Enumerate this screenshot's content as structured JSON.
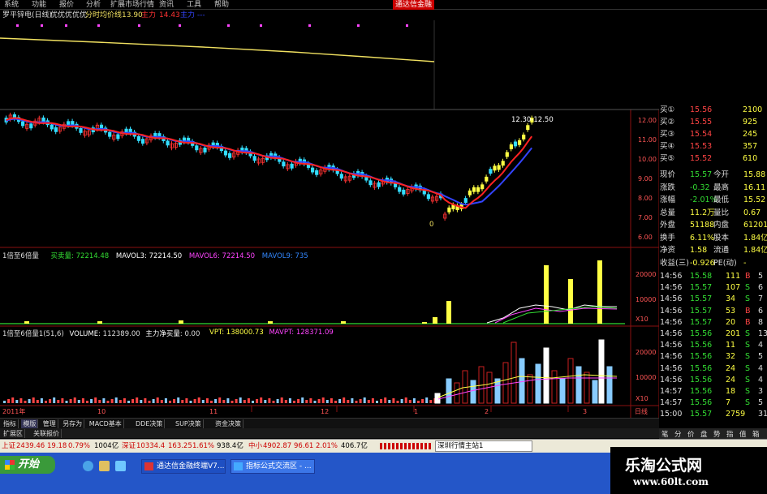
{
  "menu": {
    "items": [
      "系统",
      "功能",
      "报价",
      "分析",
      "扩展市场行情",
      "资讯",
      "工具",
      "帮助"
    ],
    "brand": "通达信金融"
  },
  "title_bar": {
    "stock": "罗平锌电(日线)",
    "indicator": "优优优优优",
    "line_label": "分时均价线",
    "line_value": "13.90",
    "leader_label": "主力",
    "leader_value": "14.43",
    "tail": "主力 ---"
  },
  "chart_data": [
    {
      "type": "line",
      "title": "",
      "y_ticks": [
        "12.00",
        "11.00",
        "10.00",
        "9.00",
        "8.00",
        "7.00",
        "6.00"
      ],
      "annotation": "12.30-12.50",
      "annotation_low": "0",
      "colors": {
        "up": "#ff3333",
        "down": "#33ddff",
        "ma1": "#ff2222",
        "ma2": "#3344ff",
        "avg": "#f0e060"
      }
    },
    {
      "type": "bar",
      "label": "1倍至6倍量",
      "items": [
        {
          "name": "买卖量",
          "value": "72214.48",
          "color": "#33dd33"
        },
        {
          "name": "MAVOL3",
          "value": "72214.50",
          "color": "#ffffff"
        },
        {
          "name": "MAVOL6",
          "value": "72214.50",
          "color": "#ff44ff"
        },
        {
          "name": "MAVOL9",
          "value": "735",
          "color": "#3388ff"
        }
      ],
      "y_ticks": [
        "20000",
        "10000",
        "X10"
      ]
    },
    {
      "type": "bar",
      "label": "1倍至6倍量1(51,6)",
      "items": [
        {
          "name": "VOLUME",
          "value": "112389.00",
          "color": "#ffffff"
        },
        {
          "name": "主力净买量",
          "value": "0.00",
          "color": "#ffffff"
        },
        {
          "name": "VPT",
          "value": "138000.73",
          "color": "#ffff44"
        },
        {
          "name": "MAVPT",
          "value": "128371.09",
          "color": "#ff44ff"
        }
      ],
      "y_ticks": [
        "20000",
        "10000",
        "X10"
      ]
    }
  ],
  "x_axis": {
    "labels": [
      "2011年",
      "10",
      "11",
      "12",
      "1",
      "2",
      "3",
      "日线"
    ]
  },
  "quote": {
    "bid_rows": [
      {
        "label": "买①",
        "price": "15.56",
        "vol": "2100"
      },
      {
        "label": "买②",
        "price": "15.55",
        "vol": "925"
      },
      {
        "label": "买③",
        "price": "15.54",
        "vol": "245"
      },
      {
        "label": "买④",
        "price": "15.53",
        "vol": "357"
      },
      {
        "label": "买⑤",
        "price": "15.52",
        "vol": "610"
      }
    ],
    "stats": [
      {
        "l1": "现价",
        "v1": "15.57",
        "l2": "今开",
        "v2": "15.88"
      },
      {
        "l1": "涨跌",
        "v1": "-0.32",
        "l2": "最高",
        "v2": "16.11"
      },
      {
        "l1": "涨幅",
        "v1": "-2.01%",
        "l2": "最低",
        "v2": "15.52"
      },
      {
        "l1": "总量",
        "v1": "11.2万",
        "l2": "量比",
        "v2": "0.67"
      },
      {
        "l1": "外盘",
        "v1": "51188",
        "l2": "内盘",
        "v2": "61201"
      },
      {
        "l1": "换手",
        "v1": "6.11%",
        "l2": "股本",
        "v2": "1.84亿"
      },
      {
        "l1": "净资",
        "v1": "1.58",
        "l2": "流通",
        "v2": "1.84亿"
      },
      {
        "l1": "收益(三)",
        "v1": "-0.926",
        "l2": "PE(动)",
        "v2": "-"
      }
    ],
    "ticks": [
      {
        "t": "14:56",
        "p": "15.58",
        "v": "111",
        "d": "B",
        "n": "5"
      },
      {
        "t": "14:56",
        "p": "15.57",
        "v": "107",
        "d": "S",
        "n": "6"
      },
      {
        "t": "14:56",
        "p": "15.57",
        "v": "34",
        "d": "S",
        "n": "7"
      },
      {
        "t": "14:56",
        "p": "15.57",
        "v": "53",
        "d": "B",
        "n": "6"
      },
      {
        "t": "14:56",
        "p": "15.57",
        "v": "20",
        "d": "B",
        "n": "8"
      },
      {
        "t": "14:56",
        "p": "15.56",
        "v": "201",
        "d": "S",
        "n": "13"
      },
      {
        "t": "14:56",
        "p": "15.56",
        "v": "11",
        "d": "S",
        "n": "4"
      },
      {
        "t": "14:56",
        "p": "15.56",
        "v": "32",
        "d": "S",
        "n": "5"
      },
      {
        "t": "14:56",
        "p": "15.56",
        "v": "24",
        "d": "S",
        "n": "4"
      },
      {
        "t": "14:56",
        "p": "15.56",
        "v": "24",
        "d": "S",
        "n": "4"
      },
      {
        "t": "14:57",
        "p": "15.56",
        "v": "18",
        "d": "S",
        "n": "3"
      },
      {
        "t": "14:57",
        "p": "15.56",
        "v": "7",
        "d": "S",
        "n": "5"
      },
      {
        "t": "15:00",
        "p": "15.57",
        "v": "2759",
        "d": "",
        "n": "316"
      }
    ]
  },
  "tabs": [
    "指标",
    "模版",
    "管理",
    "另存为",
    "MACD基本",
    "DDE决策",
    "SUP决策",
    "资金决策"
  ],
  "tabs2": [
    "扩展区",
    "关联报价"
  ],
  "side_icons": [
    "笔",
    "分",
    "价",
    "盘",
    "势",
    "指",
    "值",
    "箱"
  ],
  "index_bar": {
    "sh_label": "上证",
    "sh_value": "2439.46",
    "sh_chg": "19.18",
    "sh_pct": "0.79%",
    "sh_amt": "1004亿",
    "sz_label": "深证",
    "sz_value": "10334.4",
    "sz_chg": "163.25",
    "sz_pct": "1.61%",
    "sz_amt": "938.4亿",
    "zx_label": "中小",
    "zx_value": "4902.87",
    "zx_chg": "96.61",
    "zx_pct": "2.01%",
    "zx_amt": "406.7亿",
    "news": "深圳行情主站1"
  },
  "taskbar": {
    "start": "开始",
    "tasks": [
      "通达信金融终端V7...",
      "指标公式交流区 - ..."
    ]
  },
  "watermark": {
    "line1": "乐淘公式网",
    "line2": "www.60lt.com"
  }
}
